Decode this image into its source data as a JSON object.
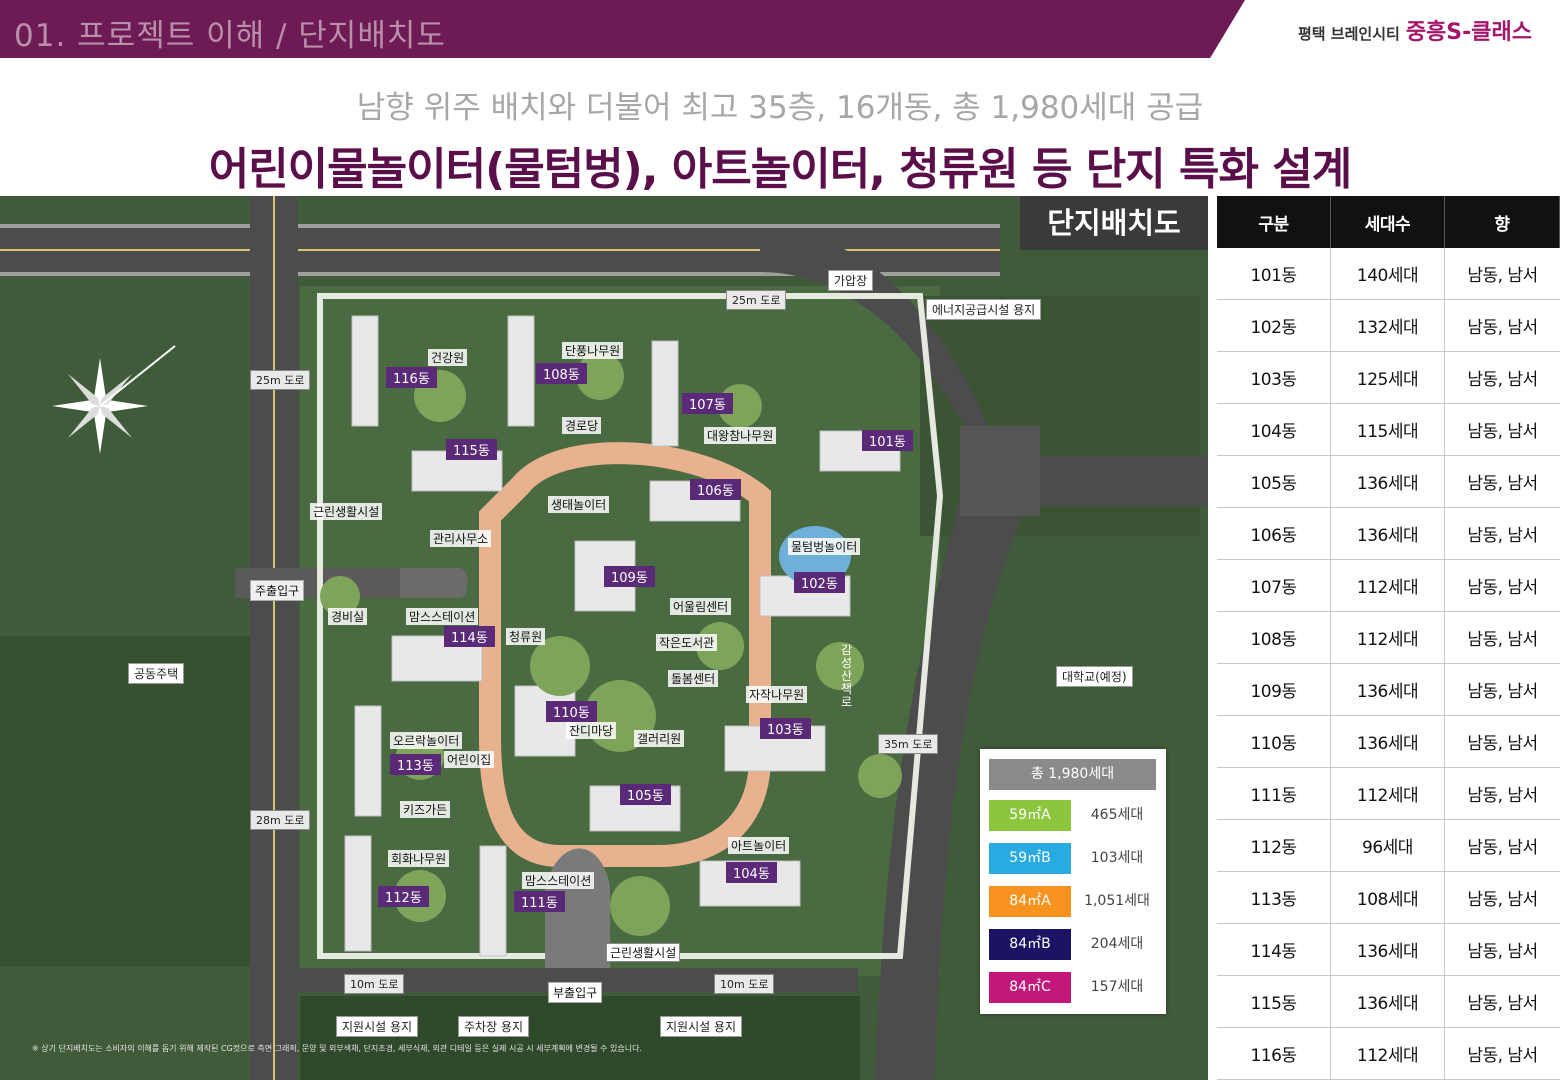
{
  "header": {
    "section_title": "01. 프로젝트 이해 / 단지배치도",
    "brand_small": "평택 브레인시티",
    "brand_main": "중흥S-클래스"
  },
  "subtitle": "남향 위주 배치와 더불어 최고 35층, 16개동, 총 1,980세대 공급",
  "headline": "어린이물놀이터(물텀벙), 아트놀이터, 청류원 등 단지 특화 설계",
  "map": {
    "tag": "단지배치도",
    "roads": {
      "r25_top": "25m 도로",
      "r25_left": "25m 도로",
      "r28_left": "28m 도로",
      "r35_right": "35m 도로",
      "r10_left": "10m 도로",
      "r10_right": "10m 도로"
    },
    "surroundings": {
      "gasstation": "가압장",
      "energy": "에너지공급시설 용지",
      "apartment": "공동주택",
      "university": "대학교(예정)",
      "support1": "지원시설 용지",
      "parking": "주차장 용지",
      "support2": "지원시설 용지",
      "street": "감성산책로"
    },
    "gates": {
      "main": "주출입구",
      "sub": "부출입구",
      "guard": "경비실"
    },
    "facilities": {
      "f1": "건강원",
      "f2": "단풍나무원",
      "f3": "경로당",
      "f4": "대왕참나무원",
      "f5": "생태놀이터",
      "f6": "근린생활시설",
      "f7": "관리사무소",
      "f8": "물텀벙놀이터",
      "f9": "맘스스테이션",
      "f10": "청류원",
      "f11": "어울림센터",
      "f12": "작은도서관",
      "f13": "돌봄센터",
      "f14": "자작나무원",
      "f15": "잔디마당",
      "f16": "갤러리원",
      "f17": "오르락놀이터",
      "f18": "어린이집",
      "f19": "키즈가든",
      "f20": "회화나무원",
      "f21": "맘스스테이션",
      "f22": "아트놀이터",
      "f23": "근린생활시설"
    },
    "buildings": [
      "101동",
      "102동",
      "103동",
      "104동",
      "105동",
      "106동",
      "107동",
      "108동",
      "109동",
      "110동",
      "111동",
      "112동",
      "113동",
      "114동",
      "115동",
      "116동"
    ],
    "disclaimer": "※ 상기 단지배치도는 소비자의 이해를 돕기 위해 제작된 CG컷으로 측면 그래픽, 문양 및 외부색채, 단지조경, 세부식재, 외관 디테일 등은 실제 시공 시 세부계획에 변경될 수 있습니다.",
    "legend": {
      "title": "총 1,980세대",
      "rows": [
        {
          "type": "59㎡A",
          "count": "465세대",
          "color": "#8cc63f"
        },
        {
          "type": "59㎡B",
          "count": "103세대",
          "color": "#29abe2"
        },
        {
          "type": "84㎡A",
          "count": "1,051세대",
          "color": "#f7931e"
        },
        {
          "type": "84㎡B",
          "count": "204세대",
          "color": "#1b1464"
        },
        {
          "type": "84㎡C",
          "count": "157세대",
          "color": "#c2187a"
        }
      ]
    }
  },
  "table": {
    "headers": [
      "구분",
      "세대수",
      "향"
    ],
    "rows": [
      [
        "101동",
        "140세대",
        "남동, 남서"
      ],
      [
        "102동",
        "132세대",
        "남동, 남서"
      ],
      [
        "103동",
        "125세대",
        "남동, 남서"
      ],
      [
        "104동",
        "115세대",
        "남동, 남서"
      ],
      [
        "105동",
        "136세대",
        "남동, 남서"
      ],
      [
        "106동",
        "136세대",
        "남동, 남서"
      ],
      [
        "107동",
        "112세대",
        "남동, 남서"
      ],
      [
        "108동",
        "112세대",
        "남동, 남서"
      ],
      [
        "109동",
        "136세대",
        "남동, 남서"
      ],
      [
        "110동",
        "136세대",
        "남동, 남서"
      ],
      [
        "111동",
        "112세대",
        "남동, 남서"
      ],
      [
        "112동",
        "96세대",
        "남동, 남서"
      ],
      [
        "113동",
        "108세대",
        "남동, 남서"
      ],
      [
        "114동",
        "136세대",
        "남동, 남서"
      ],
      [
        "115동",
        "136세대",
        "남동, 남서"
      ],
      [
        "116동",
        "112세대",
        "남동, 남서"
      ]
    ]
  },
  "colors": {
    "brand_purple": "#6e1a55",
    "headline_purple": "#5a0f4a",
    "brand_magenta": "#a4166b",
    "building_label": "#5a2a78"
  }
}
